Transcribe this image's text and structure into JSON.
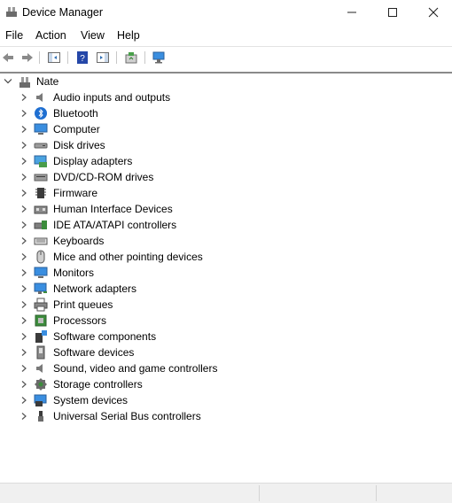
{
  "window": {
    "title": "Device Manager",
    "minimize_glyph": "—",
    "maximize_glyph": "☐",
    "close_glyph": "✕"
  },
  "menu": [
    "File",
    "Action",
    "View",
    "Help"
  ],
  "toolbar": {
    "icons": [
      "back-arrow-icon",
      "forward-arrow-icon",
      "show-hide-console-tree-icon",
      "help-icon",
      "properties-pane-icon",
      "update-driver-icon",
      "scan-hardware-icon"
    ]
  },
  "tree": {
    "root_label": "Nate",
    "items": [
      {
        "label": "Audio inputs and outputs",
        "icon": "speaker-icon"
      },
      {
        "label": "Bluetooth",
        "icon": "bluetooth-icon"
      },
      {
        "label": "Computer",
        "icon": "computer-icon"
      },
      {
        "label": "Disk drives",
        "icon": "disk-drive-icon"
      },
      {
        "label": "Display adapters",
        "icon": "display-adapter-icon"
      },
      {
        "label": "DVD/CD-ROM drives",
        "icon": "dvd-drive-icon"
      },
      {
        "label": "Firmware",
        "icon": "firmware-chip-icon"
      },
      {
        "label": "Human Interface Devices",
        "icon": "hid-icon"
      },
      {
        "label": "IDE ATA/ATAPI controllers",
        "icon": "ide-controller-icon"
      },
      {
        "label": "Keyboards",
        "icon": "keyboard-icon"
      },
      {
        "label": "Mice and other pointing devices",
        "icon": "mouse-icon"
      },
      {
        "label": "Monitors",
        "icon": "monitor-icon"
      },
      {
        "label": "Network adapters",
        "icon": "network-adapter-icon"
      },
      {
        "label": "Print queues",
        "icon": "printer-icon"
      },
      {
        "label": "Processors",
        "icon": "processor-icon"
      },
      {
        "label": "Software components",
        "icon": "software-component-icon"
      },
      {
        "label": "Software devices",
        "icon": "software-device-icon"
      },
      {
        "label": "Sound, video and game controllers",
        "icon": "sound-controller-icon"
      },
      {
        "label": "Storage controllers",
        "icon": "storage-controller-icon"
      },
      {
        "label": "System devices",
        "icon": "system-devices-icon"
      },
      {
        "label": "Universal Serial Bus controllers",
        "icon": "usb-icon"
      }
    ]
  },
  "colors": {
    "selection_border": "#8a8a8a",
    "accent": "#2b7de9",
    "status_bg": "#f0f0f0"
  }
}
